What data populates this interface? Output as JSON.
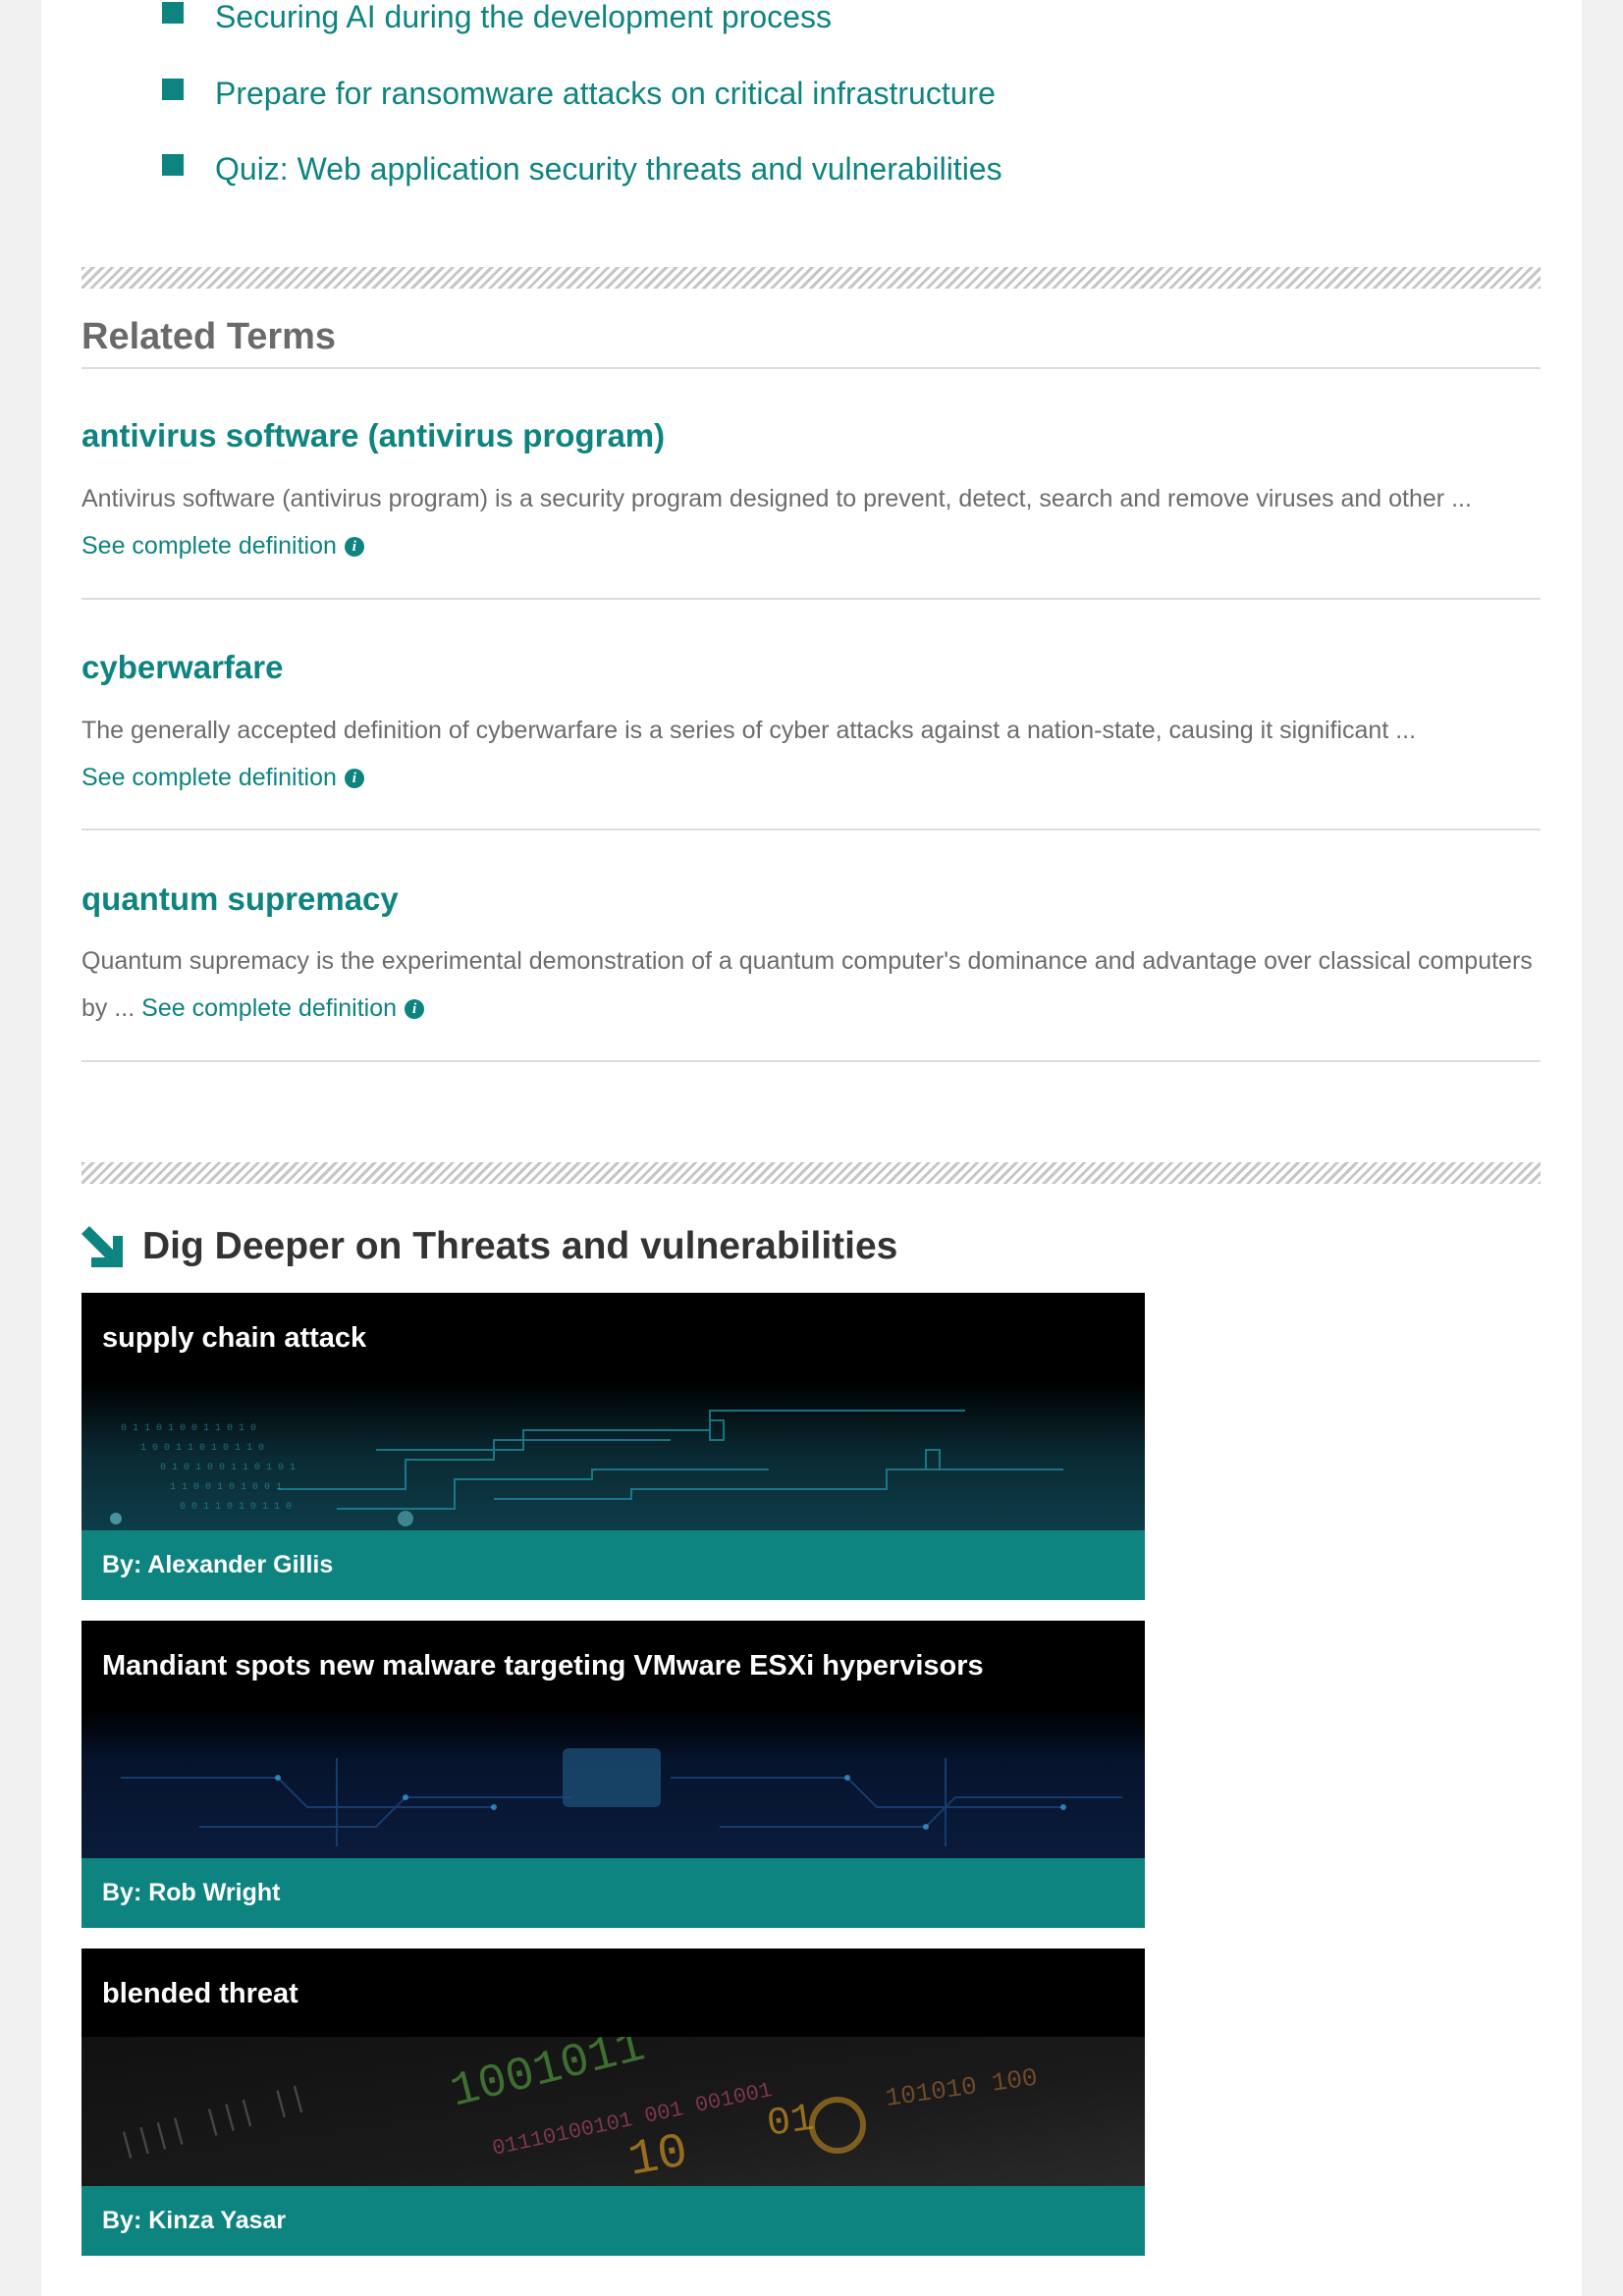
{
  "bullet_links": [
    "Securing AI during the development process",
    "Prepare for ransomware attacks on critical infrastructure",
    "Quiz: Web application security threats and vulnerabilities"
  ],
  "related_terms": {
    "heading": "Related Terms",
    "items": [
      {
        "title": "antivirus software (antivirus program)",
        "description": "Antivirus software (antivirus program) is a security program designed to prevent, detect, search and remove viruses and other ...",
        "link": "See complete definition"
      },
      {
        "title": "cyberwarfare",
        "description": "The generally accepted definition of cyberwarfare is a series of cyber attacks against a nation-state, causing it significant ...",
        "link": "See complete definition"
      },
      {
        "title": "quantum supremacy",
        "description": "Quantum supremacy is the experimental demonstration of a quantum computer's dominance and advantage over classical computers by ...",
        "link": "See complete definition"
      }
    ]
  },
  "dig_deeper": {
    "heading": "Dig Deeper on Threats and vulnerabilities",
    "icon": "arrow-down-right-icon",
    "cards": [
      {
        "title": "supply chain attack",
        "byline": "By: Alexander Gillis"
      },
      {
        "title": "Mandiant spots new malware targeting VMware ESXi hypervisors",
        "byline": "By: Rob Wright"
      },
      {
        "title": "blended threat",
        "byline": "By: Kinza Yasar"
      }
    ]
  },
  "colors": {
    "accent": "#0e8480",
    "heading_gray": "#6a6a6a",
    "text_gray": "#6c6c6c"
  }
}
